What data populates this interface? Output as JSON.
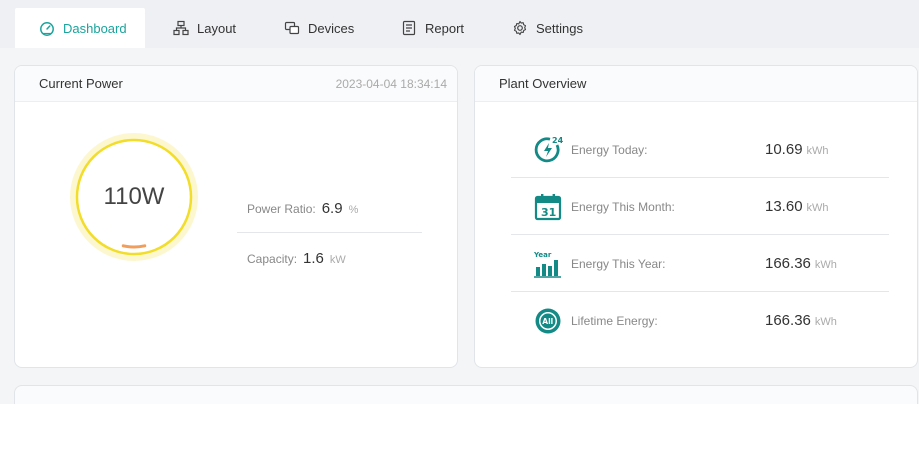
{
  "tabs": [
    {
      "label": "Dashboard",
      "icon": "dashboard-gauge-icon",
      "active": true
    },
    {
      "label": "Layout",
      "icon": "layout-sitemap-icon",
      "active": false
    },
    {
      "label": "Devices",
      "icon": "devices-icon",
      "active": false
    },
    {
      "label": "Report",
      "icon": "report-document-icon",
      "active": false
    },
    {
      "label": "Settings",
      "icon": "gear-icon",
      "active": false
    }
  ],
  "current_power": {
    "title": "Current Power",
    "timestamp": "2023-04-04 18:34:14",
    "value": "110W",
    "power_ratio_label": "Power Ratio:",
    "power_ratio_value": "6.9",
    "power_ratio_unit": "%",
    "power_ratio_fraction": 0.069,
    "capacity_label": "Capacity:",
    "capacity_value": "1.6",
    "capacity_unit": "kW"
  },
  "plant_overview": {
    "title": "Plant Overview",
    "rows": [
      {
        "icon": "energy-today-24h-icon",
        "label": "Energy Today:",
        "value": "10.69",
        "unit": "kWh"
      },
      {
        "icon": "calendar-month-31-icon",
        "label": "Energy This Month:",
        "value": "13.60",
        "unit": "kWh"
      },
      {
        "icon": "year-bar-chart-icon",
        "label": "Energy This Year:",
        "value": "166.36",
        "unit": "kWh"
      },
      {
        "icon": "lifetime-all-icon",
        "label": "Lifetime Energy:",
        "value": "166.36",
        "unit": "kWh"
      }
    ]
  },
  "colors": {
    "accent": "#1ba39c",
    "gauge_ring": "#f2dd2a",
    "gauge_halo": "#fdf7d0",
    "gauge_fill": "#f08c3c"
  }
}
